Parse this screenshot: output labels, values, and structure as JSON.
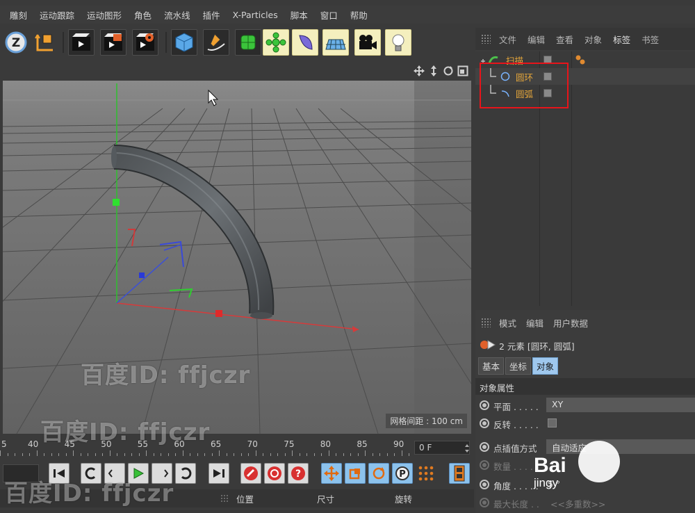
{
  "menu": [
    "雕刻",
    "运动跟踪",
    "运动图形",
    "角色",
    "流水线",
    "插件",
    "X-Particles",
    "脚本",
    "窗口",
    "帮助"
  ],
  "toolbar": {
    "icons": [
      "z-axis-lock-icon",
      "coordinate-system-icon",
      "render-view-icon",
      "render-picture-viewer-icon",
      "render-settings-icon",
      "cube-primitive-icon",
      "pen-spline-icon",
      "subdivision-generator-icon",
      "cloner-icon",
      "deformer-icon",
      "floor-plane-icon",
      "camera-icon",
      "light-icon"
    ]
  },
  "viewport": {
    "grid_spacing_label": "网格间距 : 100 cm"
  },
  "timeline": {
    "ticks": [
      "5",
      "40",
      "45",
      "50",
      "55",
      "60",
      "65",
      "70",
      "75",
      "80",
      "85",
      "90"
    ],
    "current_frame": "0 F"
  },
  "coordinates": {
    "headers": [
      "位置",
      "尺寸",
      "旋转"
    ]
  },
  "object_manager": {
    "tabs": [
      "文件",
      "编辑",
      "查看",
      "对象",
      "标签",
      "书签"
    ],
    "active_tab": "标签",
    "objects": [
      {
        "name": "扫描",
        "type": "sweep"
      },
      {
        "name": "圆环",
        "type": "circle"
      },
      {
        "name": "圆弧",
        "type": "arc"
      }
    ]
  },
  "attributes": {
    "tabs": [
      "模式",
      "编辑",
      "用户数据"
    ],
    "title": "2 元素 [圆环, 圆弧]",
    "subtabs": [
      "基本",
      "坐标",
      "对象"
    ],
    "active_subtab": "对象",
    "section": "对象属性",
    "props": [
      {
        "label": "平面",
        "dots": " . . . . .",
        "value": "XY",
        "kind": "select"
      },
      {
        "label": "反转",
        "dots": " . . . . .",
        "value": "",
        "kind": "checkbox"
      },
      {
        "label": "点插值方式",
        "dots": "",
        "value": "自动适应",
        "kind": "select"
      },
      {
        "label": "数量",
        "dots": " . . . . .",
        "value": "",
        "kind": "dim"
      },
      {
        "label": "角度",
        "dots": " . . . . .",
        "value": "5 °",
        "kind": "field"
      },
      {
        "label": "最大长度",
        "dots": " . .",
        "value": "<<多重数>>",
        "kind": "dim"
      }
    ]
  },
  "watermarks": {
    "text": "百度ID: ffjczr",
    "brand": "Bai",
    "brand_sub": "jingy"
  }
}
